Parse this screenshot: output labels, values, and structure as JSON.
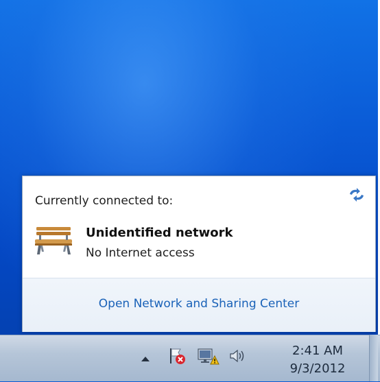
{
  "flyout": {
    "header_label": "Currently connected to:",
    "refresh_icon": "refresh-arrows-icon",
    "network": {
      "icon": "bench-icon",
      "name": "Unidentified network",
      "status": "No Internet access"
    },
    "footer_link": "Open Network and Sharing Center"
  },
  "taskbar": {
    "tray_icons": [
      "show-hidden-icons-arrow",
      "action-center-flag-error-icon",
      "network-warning-icon",
      "volume-icon"
    ],
    "clock": {
      "time": "2:41 AM",
      "date": "9/3/2012"
    }
  },
  "colors": {
    "desktop_blue": "#0a59d3",
    "link_blue": "#1a62b8",
    "warning_yellow": "#f2c21b",
    "error_red": "#d9262e"
  }
}
